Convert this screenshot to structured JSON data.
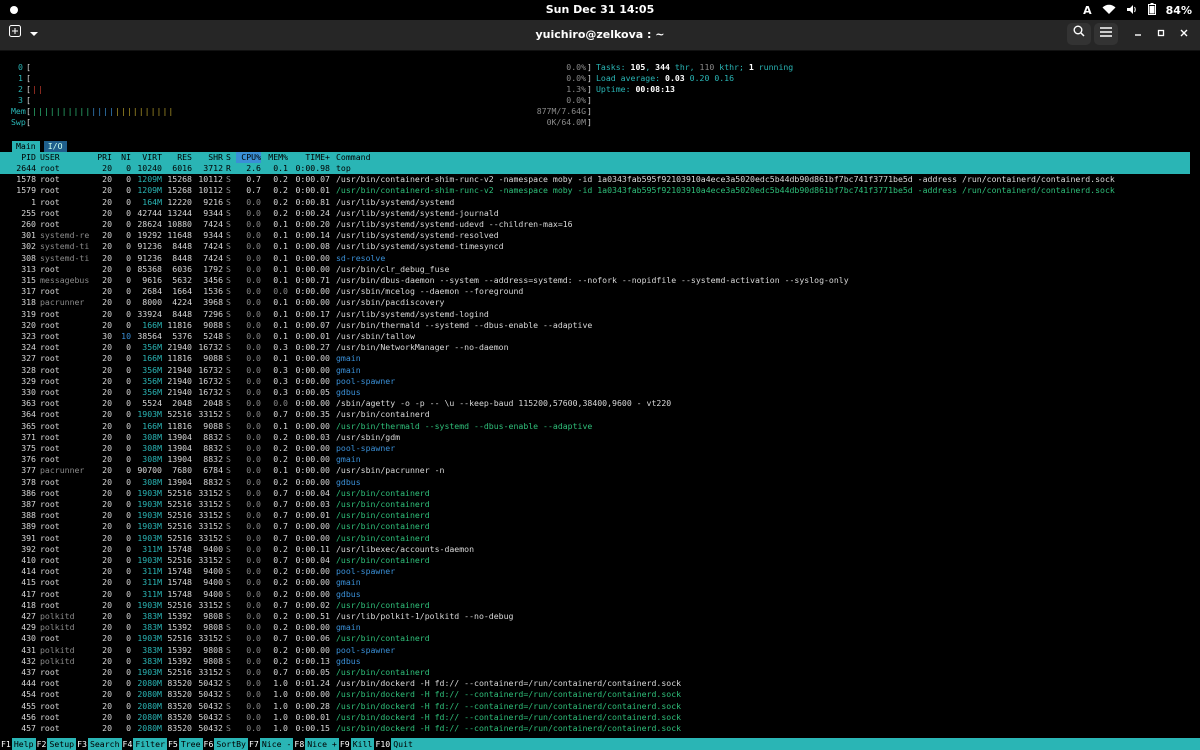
{
  "topbar": {
    "clock": "Sun Dec 31  14:05",
    "input": "A",
    "battery": "84%"
  },
  "window": {
    "title": "yuichiro@zelkova : ~"
  },
  "meters": {
    "cpus": [
      {
        "label": "0",
        "value": "0.0%"
      },
      {
        "label": "1",
        "value": "0.0%"
      },
      {
        "label": "2",
        "value": "1.3%",
        "bar": "||"
      },
      {
        "label": "3",
        "value": "0.0%"
      }
    ],
    "mem": {
      "label": "Mem",
      "value": "877M/7.64G",
      "bar": "||||||||||||||||||||||||"
    },
    "swp": {
      "label": "Swp",
      "value": "0K/64.0M"
    },
    "tasks": {
      "prefix": "Tasks: ",
      "count": "105",
      "sep1": ", ",
      "thr": "344",
      "thr_l": " thr, ",
      "kthr": "110",
      "kthr_l": " kthr; ",
      "running": "1",
      "running_l": " running"
    },
    "load": {
      "prefix": "Load average: ",
      "l1": "0.03",
      "l2": "0.20",
      "l3": "0.16"
    },
    "uptime": {
      "prefix": "Uptime: ",
      "value": "00:08:13"
    }
  },
  "tabs": [
    "Main",
    "I/O"
  ],
  "columns": [
    "PID",
    "USER",
    "PRI",
    "NI",
    "VIRT",
    "RES",
    "SHR",
    "S",
    "CPU%",
    "MEM%",
    "TIME+",
    "Command"
  ],
  "processes": [
    {
      "pid": "2644",
      "user": "root",
      "pri": "20",
      "ni": "0",
      "virt": "10240",
      "res": "6016",
      "shr": "3712",
      "s": "R",
      "cpu": "2.6",
      "mem": "0.1",
      "time": "0:00.98",
      "cmd": "top",
      "kind": "sel"
    },
    {
      "pid": "1578",
      "user": "root",
      "pri": "20",
      "ni": "0",
      "virt": "1209M",
      "res": "15268",
      "shr": "10112",
      "s": "S",
      "cpu": "0.7",
      "mem": "0.2",
      "time": "0:00.07",
      "cmd": "/usr/bin/containerd-shim-runc-v2 -namespace moby -id 1a0343fab595f92103910a4ece3a5020edc5b44db90d861bf7bc741f3771be5d -address /run/containerd/containerd.sock",
      "kind": "n"
    },
    {
      "pid": "1579",
      "user": "root",
      "pri": "20",
      "ni": "0",
      "virt": "1209M",
      "res": "15268",
      "shr": "10112",
      "s": "S",
      "cpu": "0.7",
      "mem": "0.2",
      "time": "0:00.01",
      "cmd": "/usr/bin/containerd-shim-runc-v2 -namespace moby -id 1a0343fab595f92103910a4ece3a5020edc5b44db90d861bf7bc741f3771be5d -address /run/containerd/containerd.sock",
      "kind": "g"
    },
    {
      "pid": "1",
      "user": "root",
      "pri": "20",
      "ni": "0",
      "virt": "164M",
      "res": "12220",
      "shr": "9216",
      "s": "S",
      "cpu": "0.0",
      "mem": "0.2",
      "time": "0:00.81",
      "cmd": "/usr/lib/systemd/systemd",
      "kind": "n"
    },
    {
      "pid": "255",
      "user": "root",
      "pri": "20",
      "ni": "0",
      "virt": "42744",
      "res": "13244",
      "shr": "9344",
      "s": "S",
      "cpu": "0.0",
      "mem": "0.2",
      "time": "0:00.24",
      "cmd": "/usr/lib/systemd/systemd-journald",
      "kind": "n"
    },
    {
      "pid": "260",
      "user": "root",
      "pri": "20",
      "ni": "0",
      "virt": "28624",
      "res": "10880",
      "shr": "7424",
      "s": "S",
      "cpu": "0.0",
      "mem": "0.1",
      "time": "0:00.20",
      "cmd": "/usr/lib/systemd/systemd-udevd --children-max=16",
      "kind": "n"
    },
    {
      "pid": "301",
      "user": "systemd-re",
      "pri": "20",
      "ni": "0",
      "virt": "19292",
      "res": "11648",
      "shr": "9344",
      "s": "S",
      "cpu": "0.0",
      "mem": "0.1",
      "time": "0:00.14",
      "cmd": "/usr/lib/systemd/systemd-resolved",
      "kind": "n",
      "dimuser": true
    },
    {
      "pid": "302",
      "user": "systemd-ti",
      "pri": "20",
      "ni": "0",
      "virt": "91236",
      "res": "8448",
      "shr": "7424",
      "s": "S",
      "cpu": "0.0",
      "mem": "0.1",
      "time": "0:00.08",
      "cmd": "/usr/lib/systemd/systemd-timesyncd",
      "kind": "n",
      "dimuser": true
    },
    {
      "pid": "308",
      "user": "systemd-ti",
      "pri": "20",
      "ni": "0",
      "virt": "91236",
      "res": "8448",
      "shr": "7424",
      "s": "S",
      "cpu": "0.0",
      "mem": "0.1",
      "time": "0:00.00",
      "cmd": "sd-resolve",
      "kind": "t",
      "dimuser": true
    },
    {
      "pid": "313",
      "user": "root",
      "pri": "20",
      "ni": "0",
      "virt": "85368",
      "res": "6036",
      "shr": "1792",
      "s": "S",
      "cpu": "0.0",
      "mem": "0.1",
      "time": "0:00.00",
      "cmd": "/usr/bin/clr_debug_fuse",
      "kind": "n"
    },
    {
      "pid": "315",
      "user": "messagebus",
      "pri": "20",
      "ni": "0",
      "virt": "9616",
      "res": "5632",
      "shr": "3456",
      "s": "S",
      "cpu": "0.0",
      "mem": "0.1",
      "time": "0:00.71",
      "cmd": "/usr/bin/dbus-daemon --system --address=systemd: --nofork --nopidfile --systemd-activation --syslog-only",
      "kind": "n",
      "dimuser": true
    },
    {
      "pid": "317",
      "user": "root",
      "pri": "20",
      "ni": "0",
      "virt": "2684",
      "res": "1664",
      "shr": "1536",
      "s": "S",
      "cpu": "0.0",
      "mem": "0.0",
      "time": "0:00.00",
      "cmd": "/usr/sbin/mcelog --daemon --foreground",
      "kind": "n"
    },
    {
      "pid": "318",
      "user": "pacrunner",
      "pri": "20",
      "ni": "0",
      "virt": "8000",
      "res": "4224",
      "shr": "3968",
      "s": "S",
      "cpu": "0.0",
      "mem": "0.1",
      "time": "0:00.00",
      "cmd": "/usr/sbin/pacdiscovery",
      "kind": "n",
      "dimuser": true
    },
    {
      "pid": "319",
      "user": "root",
      "pri": "20",
      "ni": "0",
      "virt": "33924",
      "res": "8448",
      "shr": "7296",
      "s": "S",
      "cpu": "0.0",
      "mem": "0.1",
      "time": "0:00.17",
      "cmd": "/usr/lib/systemd/systemd-logind",
      "kind": "n"
    },
    {
      "pid": "320",
      "user": "root",
      "pri": "20",
      "ni": "0",
      "virt": "166M",
      "res": "11816",
      "shr": "9088",
      "s": "S",
      "cpu": "0.0",
      "mem": "0.1",
      "time": "0:00.07",
      "cmd": "/usr/bin/thermald --systemd --dbus-enable --adaptive",
      "kind": "n"
    },
    {
      "pid": "323",
      "user": "root",
      "pri": "30",
      "ni": "10",
      "virt": "38564",
      "res": "5376",
      "shr": "5248",
      "s": "S",
      "cpu": "0.0",
      "mem": "0.1",
      "time": "0:00.01",
      "cmd": "/usr/sbin/tallow",
      "kind": "n"
    },
    {
      "pid": "324",
      "user": "root",
      "pri": "20",
      "ni": "0",
      "virt": "356M",
      "res": "21940",
      "shr": "16732",
      "s": "S",
      "cpu": "0.0",
      "mem": "0.3",
      "time": "0:00.27",
      "cmd": "/usr/bin/NetworkManager --no-daemon",
      "kind": "n"
    },
    {
      "pid": "327",
      "user": "root",
      "pri": "20",
      "ni": "0",
      "virt": "166M",
      "res": "11816",
      "shr": "9088",
      "s": "S",
      "cpu": "0.0",
      "mem": "0.1",
      "time": "0:00.00",
      "cmd": "gmain",
      "kind": "t"
    },
    {
      "pid": "328",
      "user": "root",
      "pri": "20",
      "ni": "0",
      "virt": "356M",
      "res": "21940",
      "shr": "16732",
      "s": "S",
      "cpu": "0.0",
      "mem": "0.3",
      "time": "0:00.00",
      "cmd": "gmain",
      "kind": "t"
    },
    {
      "pid": "329",
      "user": "root",
      "pri": "20",
      "ni": "0",
      "virt": "356M",
      "res": "21940",
      "shr": "16732",
      "s": "S",
      "cpu": "0.0",
      "mem": "0.3",
      "time": "0:00.00",
      "cmd": "pool-spawner",
      "kind": "t"
    },
    {
      "pid": "330",
      "user": "root",
      "pri": "20",
      "ni": "0",
      "virt": "356M",
      "res": "21940",
      "shr": "16732",
      "s": "S",
      "cpu": "0.0",
      "mem": "0.3",
      "time": "0:00.05",
      "cmd": "gdbus",
      "kind": "t"
    },
    {
      "pid": "363",
      "user": "root",
      "pri": "20",
      "ni": "0",
      "virt": "5524",
      "res": "2048",
      "shr": "2048",
      "s": "S",
      "cpu": "0.0",
      "mem": "0.0",
      "time": "0:00.00",
      "cmd": "/sbin/agetty -o -p -- \\u --keep-baud 115200,57600,38400,9600 - vt220",
      "kind": "n"
    },
    {
      "pid": "364",
      "user": "root",
      "pri": "20",
      "ni": "0",
      "virt": "1903M",
      "res": "52516",
      "shr": "33152",
      "s": "S",
      "cpu": "0.0",
      "mem": "0.7",
      "time": "0:00.35",
      "cmd": "/usr/bin/containerd",
      "kind": "n"
    },
    {
      "pid": "365",
      "user": "root",
      "pri": "20",
      "ni": "0",
      "virt": "166M",
      "res": "11816",
      "shr": "9088",
      "s": "S",
      "cpu": "0.0",
      "mem": "0.1",
      "time": "0:00.00",
      "cmd": "/usr/bin/thermald --systemd --dbus-enable --adaptive",
      "kind": "g"
    },
    {
      "pid": "371",
      "user": "root",
      "pri": "20",
      "ni": "0",
      "virt": "308M",
      "res": "13904",
      "shr": "8832",
      "s": "S",
      "cpu": "0.0",
      "mem": "0.2",
      "time": "0:00.03",
      "cmd": "/usr/sbin/gdm",
      "kind": "n"
    },
    {
      "pid": "375",
      "user": "root",
      "pri": "20",
      "ni": "0",
      "virt": "308M",
      "res": "13904",
      "shr": "8832",
      "s": "S",
      "cpu": "0.0",
      "mem": "0.2",
      "time": "0:00.00",
      "cmd": "pool-spawner",
      "kind": "t"
    },
    {
      "pid": "376",
      "user": "root",
      "pri": "20",
      "ni": "0",
      "virt": "308M",
      "res": "13904",
      "shr": "8832",
      "s": "S",
      "cpu": "0.0",
      "mem": "0.2",
      "time": "0:00.00",
      "cmd": "gmain",
      "kind": "t"
    },
    {
      "pid": "377",
      "user": "pacrunner",
      "pri": "20",
      "ni": "0",
      "virt": "90700",
      "res": "7680",
      "shr": "6784",
      "s": "S",
      "cpu": "0.0",
      "mem": "0.1",
      "time": "0:00.00",
      "cmd": "/usr/sbin/pacrunner -n",
      "kind": "n",
      "dimuser": true
    },
    {
      "pid": "378",
      "user": "root",
      "pri": "20",
      "ni": "0",
      "virt": "308M",
      "res": "13904",
      "shr": "8832",
      "s": "S",
      "cpu": "0.0",
      "mem": "0.2",
      "time": "0:00.00",
      "cmd": "gdbus",
      "kind": "t"
    },
    {
      "pid": "386",
      "user": "root",
      "pri": "20",
      "ni": "0",
      "virt": "1903M",
      "res": "52516",
      "shr": "33152",
      "s": "S",
      "cpu": "0.0",
      "mem": "0.7",
      "time": "0:00.04",
      "cmd": "/usr/bin/containerd",
      "kind": "g"
    },
    {
      "pid": "387",
      "user": "root",
      "pri": "20",
      "ni": "0",
      "virt": "1903M",
      "res": "52516",
      "shr": "33152",
      "s": "S",
      "cpu": "0.0",
      "mem": "0.7",
      "time": "0:00.03",
      "cmd": "/usr/bin/containerd",
      "kind": "g"
    },
    {
      "pid": "388",
      "user": "root",
      "pri": "20",
      "ni": "0",
      "virt": "1903M",
      "res": "52516",
      "shr": "33152",
      "s": "S",
      "cpu": "0.0",
      "mem": "0.7",
      "time": "0:00.01",
      "cmd": "/usr/bin/containerd",
      "kind": "g"
    },
    {
      "pid": "389",
      "user": "root",
      "pri": "20",
      "ni": "0",
      "virt": "1903M",
      "res": "52516",
      "shr": "33152",
      "s": "S",
      "cpu": "0.0",
      "mem": "0.7",
      "time": "0:00.00",
      "cmd": "/usr/bin/containerd",
      "kind": "g"
    },
    {
      "pid": "391",
      "user": "root",
      "pri": "20",
      "ni": "0",
      "virt": "1903M",
      "res": "52516",
      "shr": "33152",
      "s": "S",
      "cpu": "0.0",
      "mem": "0.7",
      "time": "0:00.00",
      "cmd": "/usr/bin/containerd",
      "kind": "g"
    },
    {
      "pid": "392",
      "user": "root",
      "pri": "20",
      "ni": "0",
      "virt": "311M",
      "res": "15748",
      "shr": "9400",
      "s": "S",
      "cpu": "0.0",
      "mem": "0.2",
      "time": "0:00.11",
      "cmd": "/usr/libexec/accounts-daemon",
      "kind": "n"
    },
    {
      "pid": "410",
      "user": "root",
      "pri": "20",
      "ni": "0",
      "virt": "1903M",
      "res": "52516",
      "shr": "33152",
      "s": "S",
      "cpu": "0.0",
      "mem": "0.7",
      "time": "0:00.04",
      "cmd": "/usr/bin/containerd",
      "kind": "g"
    },
    {
      "pid": "414",
      "user": "root",
      "pri": "20",
      "ni": "0",
      "virt": "311M",
      "res": "15748",
      "shr": "9400",
      "s": "S",
      "cpu": "0.0",
      "mem": "0.2",
      "time": "0:00.00",
      "cmd": "pool-spawner",
      "kind": "t"
    },
    {
      "pid": "415",
      "user": "root",
      "pri": "20",
      "ni": "0",
      "virt": "311M",
      "res": "15748",
      "shr": "9400",
      "s": "S",
      "cpu": "0.0",
      "mem": "0.2",
      "time": "0:00.00",
      "cmd": "gmain",
      "kind": "t"
    },
    {
      "pid": "417",
      "user": "root",
      "pri": "20",
      "ni": "0",
      "virt": "311M",
      "res": "15748",
      "shr": "9400",
      "s": "S",
      "cpu": "0.0",
      "mem": "0.2",
      "time": "0:00.00",
      "cmd": "gdbus",
      "kind": "t"
    },
    {
      "pid": "418",
      "user": "root",
      "pri": "20",
      "ni": "0",
      "virt": "1903M",
      "res": "52516",
      "shr": "33152",
      "s": "S",
      "cpu": "0.0",
      "mem": "0.7",
      "time": "0:00.02",
      "cmd": "/usr/bin/containerd",
      "kind": "g"
    },
    {
      "pid": "427",
      "user": "polkitd",
      "pri": "20",
      "ni": "0",
      "virt": "383M",
      "res": "15392",
      "shr": "9808",
      "s": "S",
      "cpu": "0.0",
      "mem": "0.2",
      "time": "0:00.51",
      "cmd": "/usr/lib/polkit-1/polkitd --no-debug",
      "kind": "n",
      "dimuser": true
    },
    {
      "pid": "429",
      "user": "polkitd",
      "pri": "20",
      "ni": "0",
      "virt": "383M",
      "res": "15392",
      "shr": "9808",
      "s": "S",
      "cpu": "0.0",
      "mem": "0.2",
      "time": "0:00.00",
      "cmd": "gmain",
      "kind": "t",
      "dimuser": true
    },
    {
      "pid": "430",
      "user": "root",
      "pri": "20",
      "ni": "0",
      "virt": "1903M",
      "res": "52516",
      "shr": "33152",
      "s": "S",
      "cpu": "0.0",
      "mem": "0.7",
      "time": "0:00.06",
      "cmd": "/usr/bin/containerd",
      "kind": "g"
    },
    {
      "pid": "431",
      "user": "polkitd",
      "pri": "20",
      "ni": "0",
      "virt": "383M",
      "res": "15392",
      "shr": "9808",
      "s": "S",
      "cpu": "0.0",
      "mem": "0.2",
      "time": "0:00.00",
      "cmd": "pool-spawner",
      "kind": "t",
      "dimuser": true
    },
    {
      "pid": "432",
      "user": "polkitd",
      "pri": "20",
      "ni": "0",
      "virt": "383M",
      "res": "15392",
      "shr": "9808",
      "s": "S",
      "cpu": "0.0",
      "mem": "0.2",
      "time": "0:00.13",
      "cmd": "gdbus",
      "kind": "t",
      "dimuser": true
    },
    {
      "pid": "437",
      "user": "root",
      "pri": "20",
      "ni": "0",
      "virt": "1903M",
      "res": "52516",
      "shr": "33152",
      "s": "S",
      "cpu": "0.0",
      "mem": "0.7",
      "time": "0:00.05",
      "cmd": "/usr/bin/containerd",
      "kind": "g"
    },
    {
      "pid": "444",
      "user": "root",
      "pri": "20",
      "ni": "0",
      "virt": "2080M",
      "res": "83520",
      "shr": "50432",
      "s": "S",
      "cpu": "0.0",
      "mem": "1.0",
      "time": "0:01.24",
      "cmd": "/usr/bin/dockerd -H fd:// --containerd=/run/containerd/containerd.sock",
      "kind": "n"
    },
    {
      "pid": "454",
      "user": "root",
      "pri": "20",
      "ni": "0",
      "virt": "2080M",
      "res": "83520",
      "shr": "50432",
      "s": "S",
      "cpu": "0.0",
      "mem": "1.0",
      "time": "0:00.00",
      "cmd": "/usr/bin/dockerd -H fd:// --containerd=/run/containerd/containerd.sock",
      "kind": "g"
    },
    {
      "pid": "455",
      "user": "root",
      "pri": "20",
      "ni": "0",
      "virt": "2080M",
      "res": "83520",
      "shr": "50432",
      "s": "S",
      "cpu": "0.0",
      "mem": "1.0",
      "time": "0:00.28",
      "cmd": "/usr/bin/dockerd -H fd:// --containerd=/run/containerd/containerd.sock",
      "kind": "g"
    },
    {
      "pid": "456",
      "user": "root",
      "pri": "20",
      "ni": "0",
      "virt": "2080M",
      "res": "83520",
      "shr": "50432",
      "s": "S",
      "cpu": "0.0",
      "mem": "1.0",
      "time": "0:00.01",
      "cmd": "/usr/bin/dockerd -H fd:// --containerd=/run/containerd/containerd.sock",
      "kind": "g"
    },
    {
      "pid": "457",
      "user": "root",
      "pri": "20",
      "ni": "0",
      "virt": "2080M",
      "res": "83520",
      "shr": "50432",
      "s": "S",
      "cpu": "0.0",
      "mem": "1.0",
      "time": "0:00.15",
      "cmd": "/usr/bin/dockerd -H fd:// --containerd=/run/containerd/containerd.sock",
      "kind": "g"
    }
  ],
  "fkeys": [
    {
      "key": "F1",
      "label": "Help"
    },
    {
      "key": "F2",
      "label": "Setup"
    },
    {
      "key": "F3",
      "label": "Search"
    },
    {
      "key": "F4",
      "label": "Filter"
    },
    {
      "key": "F5",
      "label": "Tree"
    },
    {
      "key": "F6",
      "label": "SortBy"
    },
    {
      "key": "F7",
      "label": "Nice -"
    },
    {
      "key": "F8",
      "label": "Nice +"
    },
    {
      "key": "F9",
      "label": "Kill"
    },
    {
      "key": "F10",
      "label": "Quit"
    }
  ]
}
